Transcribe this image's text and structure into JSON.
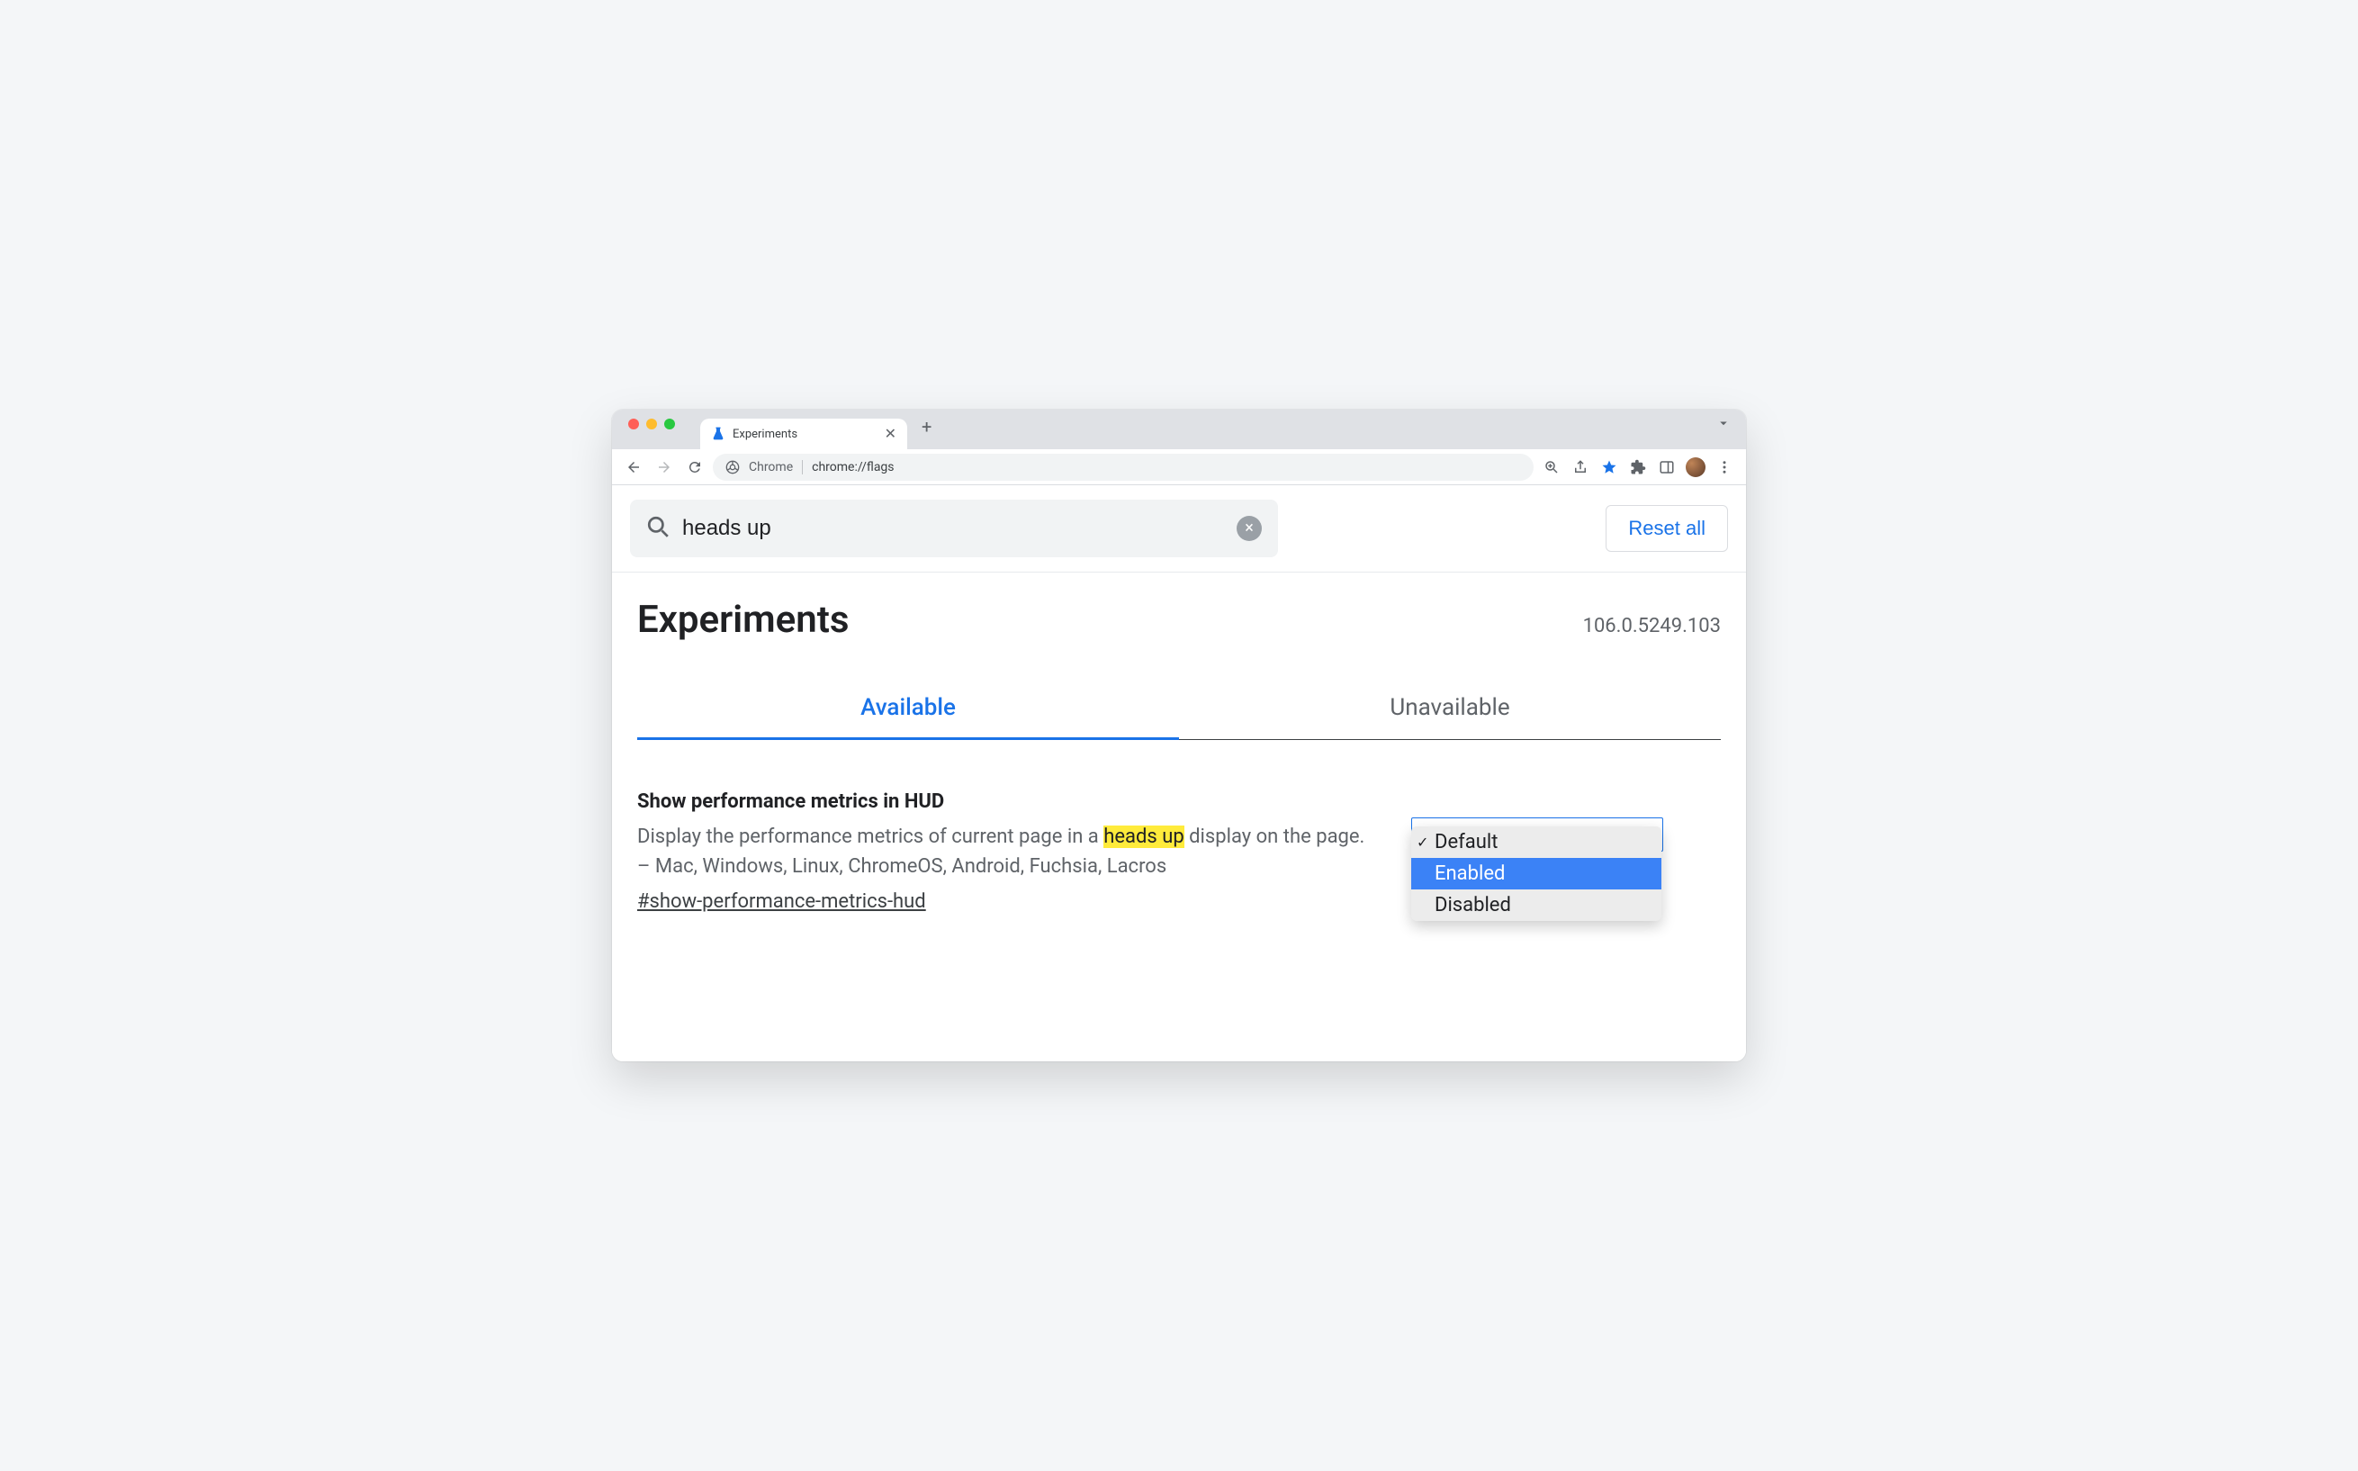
{
  "window": {
    "tab_title": "Experiments",
    "new_tab_label": "+"
  },
  "toolbar": {
    "chrome_label": "Chrome",
    "url": "chrome://flags"
  },
  "search": {
    "value": "heads up",
    "clear_label": "×"
  },
  "reset_label": "Reset all",
  "page_title": "Experiments",
  "version": "106.0.5249.103",
  "tabs": {
    "available": "Available",
    "unavailable": "Unavailable"
  },
  "experiment": {
    "name": "Show performance metrics in HUD",
    "desc_before": "Display the performance metrics of current page in a ",
    "desc_highlight": "heads up",
    "desc_after": " display on the page. – Mac, Windows, Linux, ChromeOS, Android, Fuchsia, Lacros",
    "hash": "#show-performance-metrics-hud",
    "options": {
      "default": "Default",
      "enabled": "Enabled",
      "disabled": "Disabled"
    }
  }
}
